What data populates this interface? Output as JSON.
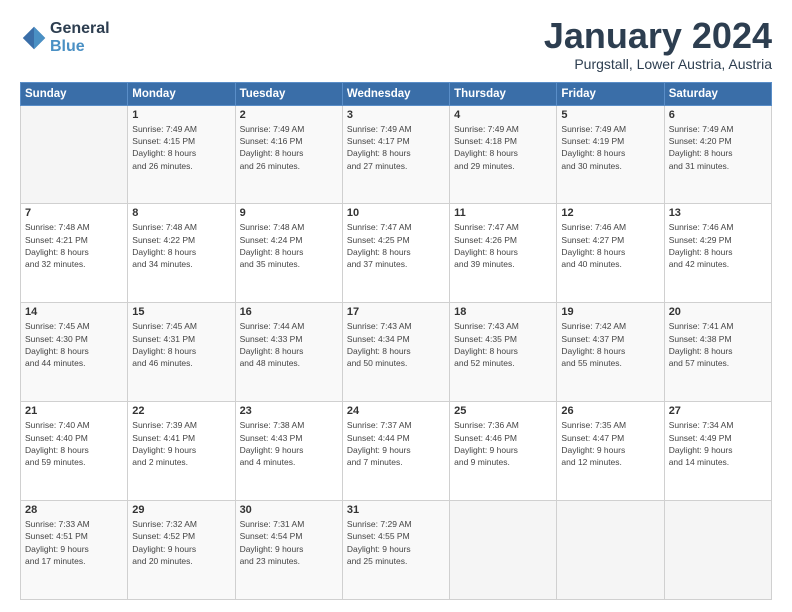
{
  "header": {
    "logo_line1": "General",
    "logo_line2": "Blue",
    "month": "January 2024",
    "location": "Purgstall, Lower Austria, Austria"
  },
  "weekdays": [
    "Sunday",
    "Monday",
    "Tuesday",
    "Wednesday",
    "Thursday",
    "Friday",
    "Saturday"
  ],
  "weeks": [
    [
      {
        "day": "",
        "info": ""
      },
      {
        "day": "1",
        "info": "Sunrise: 7:49 AM\nSunset: 4:15 PM\nDaylight: 8 hours\nand 26 minutes."
      },
      {
        "day": "2",
        "info": "Sunrise: 7:49 AM\nSunset: 4:16 PM\nDaylight: 8 hours\nand 26 minutes."
      },
      {
        "day": "3",
        "info": "Sunrise: 7:49 AM\nSunset: 4:17 PM\nDaylight: 8 hours\nand 27 minutes."
      },
      {
        "day": "4",
        "info": "Sunrise: 7:49 AM\nSunset: 4:18 PM\nDaylight: 8 hours\nand 29 minutes."
      },
      {
        "day": "5",
        "info": "Sunrise: 7:49 AM\nSunset: 4:19 PM\nDaylight: 8 hours\nand 30 minutes."
      },
      {
        "day": "6",
        "info": "Sunrise: 7:49 AM\nSunset: 4:20 PM\nDaylight: 8 hours\nand 31 minutes."
      }
    ],
    [
      {
        "day": "7",
        "info": "Sunrise: 7:48 AM\nSunset: 4:21 PM\nDaylight: 8 hours\nand 32 minutes."
      },
      {
        "day": "8",
        "info": "Sunrise: 7:48 AM\nSunset: 4:22 PM\nDaylight: 8 hours\nand 34 minutes."
      },
      {
        "day": "9",
        "info": "Sunrise: 7:48 AM\nSunset: 4:24 PM\nDaylight: 8 hours\nand 35 minutes."
      },
      {
        "day": "10",
        "info": "Sunrise: 7:47 AM\nSunset: 4:25 PM\nDaylight: 8 hours\nand 37 minutes."
      },
      {
        "day": "11",
        "info": "Sunrise: 7:47 AM\nSunset: 4:26 PM\nDaylight: 8 hours\nand 39 minutes."
      },
      {
        "day": "12",
        "info": "Sunrise: 7:46 AM\nSunset: 4:27 PM\nDaylight: 8 hours\nand 40 minutes."
      },
      {
        "day": "13",
        "info": "Sunrise: 7:46 AM\nSunset: 4:29 PM\nDaylight: 8 hours\nand 42 minutes."
      }
    ],
    [
      {
        "day": "14",
        "info": "Sunrise: 7:45 AM\nSunset: 4:30 PM\nDaylight: 8 hours\nand 44 minutes."
      },
      {
        "day": "15",
        "info": "Sunrise: 7:45 AM\nSunset: 4:31 PM\nDaylight: 8 hours\nand 46 minutes."
      },
      {
        "day": "16",
        "info": "Sunrise: 7:44 AM\nSunset: 4:33 PM\nDaylight: 8 hours\nand 48 minutes."
      },
      {
        "day": "17",
        "info": "Sunrise: 7:43 AM\nSunset: 4:34 PM\nDaylight: 8 hours\nand 50 minutes."
      },
      {
        "day": "18",
        "info": "Sunrise: 7:43 AM\nSunset: 4:35 PM\nDaylight: 8 hours\nand 52 minutes."
      },
      {
        "day": "19",
        "info": "Sunrise: 7:42 AM\nSunset: 4:37 PM\nDaylight: 8 hours\nand 55 minutes."
      },
      {
        "day": "20",
        "info": "Sunrise: 7:41 AM\nSunset: 4:38 PM\nDaylight: 8 hours\nand 57 minutes."
      }
    ],
    [
      {
        "day": "21",
        "info": "Sunrise: 7:40 AM\nSunset: 4:40 PM\nDaylight: 8 hours\nand 59 minutes."
      },
      {
        "day": "22",
        "info": "Sunrise: 7:39 AM\nSunset: 4:41 PM\nDaylight: 9 hours\nand 2 minutes."
      },
      {
        "day": "23",
        "info": "Sunrise: 7:38 AM\nSunset: 4:43 PM\nDaylight: 9 hours\nand 4 minutes."
      },
      {
        "day": "24",
        "info": "Sunrise: 7:37 AM\nSunset: 4:44 PM\nDaylight: 9 hours\nand 7 minutes."
      },
      {
        "day": "25",
        "info": "Sunrise: 7:36 AM\nSunset: 4:46 PM\nDaylight: 9 hours\nand 9 minutes."
      },
      {
        "day": "26",
        "info": "Sunrise: 7:35 AM\nSunset: 4:47 PM\nDaylight: 9 hours\nand 12 minutes."
      },
      {
        "day": "27",
        "info": "Sunrise: 7:34 AM\nSunset: 4:49 PM\nDaylight: 9 hours\nand 14 minutes."
      }
    ],
    [
      {
        "day": "28",
        "info": "Sunrise: 7:33 AM\nSunset: 4:51 PM\nDaylight: 9 hours\nand 17 minutes."
      },
      {
        "day": "29",
        "info": "Sunrise: 7:32 AM\nSunset: 4:52 PM\nDaylight: 9 hours\nand 20 minutes."
      },
      {
        "day": "30",
        "info": "Sunrise: 7:31 AM\nSunset: 4:54 PM\nDaylight: 9 hours\nand 23 minutes."
      },
      {
        "day": "31",
        "info": "Sunrise: 7:29 AM\nSunset: 4:55 PM\nDaylight: 9 hours\nand 25 minutes."
      },
      {
        "day": "",
        "info": ""
      },
      {
        "day": "",
        "info": ""
      },
      {
        "day": "",
        "info": ""
      }
    ]
  ]
}
